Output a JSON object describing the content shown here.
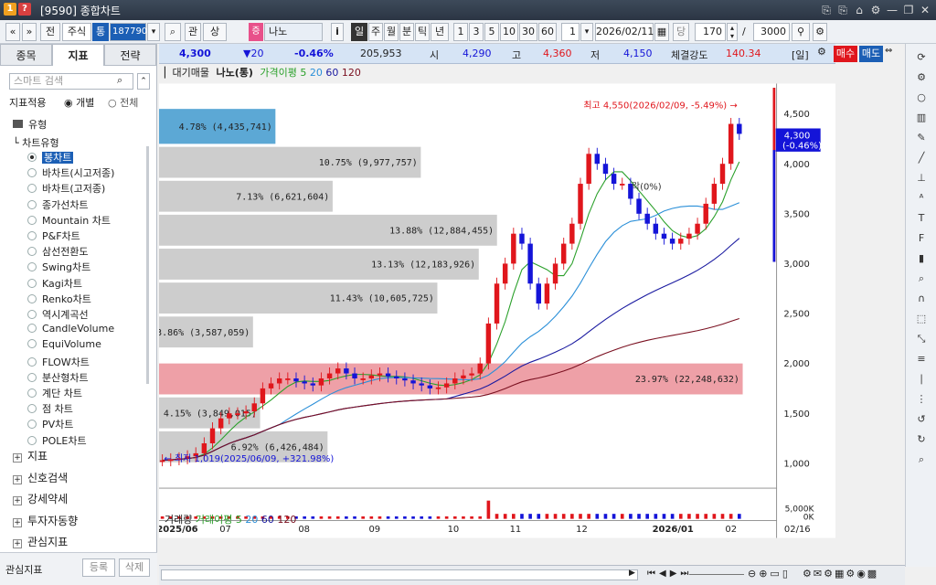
{
  "window": {
    "badge1": "1",
    "badge2": "?",
    "title": "[9590] 종합차트",
    "controls": [
      "⎘",
      "⎘",
      "⌂",
      "⚙",
      "—",
      "❐",
      "✕"
    ]
  },
  "toolbar": {
    "nav_prev": "«",
    "nav_down": "»",
    "btn_jeon": "전",
    "asset_type": "주식",
    "tong": "통",
    "code": "187790",
    "btn_gwan": "관",
    "btn_sang": "상",
    "jeung": "증",
    "stock_name": "나노",
    "info": "i",
    "periods": [
      "일",
      "주",
      "월",
      "분",
      "틱",
      "년"
    ],
    "active_period": "일",
    "intervals": [
      "1",
      "3",
      "5",
      "10",
      "30",
      "60"
    ],
    "num1": "1",
    "date": "2026/02/11",
    "dang": "당",
    "count": "170",
    "slash": "/",
    "total": "3000"
  },
  "left": {
    "tabs": [
      "종목",
      "지표",
      "전략"
    ],
    "active_tab": "지표",
    "search_placeholder": "스마트 검색",
    "apply_label": "지표적용",
    "apply_opt1": "개별",
    "apply_opt2": "전체",
    "section_type": "유형",
    "chart_type_header": "차트유형",
    "chart_types": [
      "봉차트",
      "바차트(시고저종)",
      "바차트(고저종)",
      "종가선차트",
      "Mountain 차트",
      "P&F차트",
      "삼선전환도",
      "Swing차트",
      "Kagi차트",
      "Renko차트",
      "역시계곡선",
      "CandleVolume",
      "EquiVolume",
      "FLOW차트",
      "분산형차트",
      "계단 차트",
      "점 차트",
      "PV차트",
      "POLE차트"
    ],
    "selected_type": "봉차트",
    "groups": [
      "지표",
      "신호검색",
      "강세약세",
      "투자자동향",
      "관심지표"
    ],
    "footer_label": "관심지표",
    "footer_btn1": "등록",
    "footer_btn2": "삭제"
  },
  "price": {
    "current": "4,300",
    "change": "▼20",
    "change_pct": "-0.46%",
    "volume": "205,953",
    "open_label": "시",
    "open": "4,290",
    "high_label": "고",
    "high": "4,360",
    "low_label": "저",
    "low": "4,150",
    "strength_label": "체결강도",
    "strength": "140.34",
    "period_tag": "[일]",
    "buy": "매수",
    "sell": "매도"
  },
  "chart_legend": {
    "vp": "대기매물",
    "name": "나노(통)",
    "ma_label": "가격이평 5",
    "ma20": "20",
    "ma60": "60",
    "ma120": "120"
  },
  "volume_legend": {
    "title": "거래량",
    "ma_label": "거래이평 5",
    "ma20": "20",
    "ma60": "60",
    "ma120": "120"
  },
  "annotations": {
    "high": "최고 4,550(2026/02/09, -5.49%)",
    "low": "최저 1,019(2025/06/09, +321.98%)",
    "price_tag": "4,300",
    "price_tag_pct": "(-0.46%)",
    "mid_label": "락(0%)"
  },
  "colors": {
    "up": "#e0161c",
    "down": "#1414d8",
    "ma5": "#2aa02a",
    "ma20": "#2a8fd8",
    "ma60": "#1a1aa0",
    "ma120": "#7a1020",
    "vp_bar": "#c8c8c8",
    "vp_highlight": "#e8808a",
    "vp_first": "#4a9ed0"
  },
  "chart_data": {
    "type": "candlestick",
    "y_ticks": [
      "4,500",
      "4,000",
      "3,500",
      "3,000",
      "2,500",
      "2,000",
      "1,500",
      "1,000"
    ],
    "ylim": [
      900,
      4720
    ],
    "x_ticks": [
      "2025/06",
      "07",
      "08",
      "09",
      "10",
      "11",
      "12",
      "2026/01",
      "02"
    ],
    "vol_ticks": [
      "5,000K",
      "0K"
    ],
    "last_date": "02/16",
    "volume_profile": [
      {
        "low": 4200,
        "high": 4550,
        "pct": 4.78,
        "label": "4.78% (4,435,741)"
      },
      {
        "low": 3860,
        "high": 4170,
        "pct": 10.75,
        "label": "10.75% (9,977,757)"
      },
      {
        "low": 3520,
        "high": 3830,
        "pct": 7.13,
        "label": "7.13% (6,621,604)"
      },
      {
        "low": 3180,
        "high": 3490,
        "pct": 13.88,
        "label": "13.88% (12,884,455)"
      },
      {
        "low": 2840,
        "high": 3150,
        "pct": 13.13,
        "label": "13.13% (12,183,926)"
      },
      {
        "low": 2500,
        "high": 2810,
        "pct": 11.43,
        "label": "11.43% (10,605,725)"
      },
      {
        "low": 2160,
        "high": 2470,
        "pct": 3.86,
        "label": "3.86% (3,587,059)"
      },
      {
        "low": 1690,
        "high": 2000,
        "pct": 23.97,
        "label": "23.97% (22,248,632)",
        "highlight": true
      },
      {
        "low": 1350,
        "high": 1660,
        "pct": 4.15,
        "label": "4.15% (3,849,015)"
      },
      {
        "low": 1010,
        "high": 1320,
        "pct": 6.92,
        "label": "6.92% (6,426,484)"
      }
    ],
    "close_path": [
      1030,
      1040,
      1050,
      1070,
      1100,
      1200,
      1350,
      1450,
      1500,
      1500,
      1520,
      1600,
      1750,
      1800,
      1850,
      1850,
      1820,
      1800,
      1780,
      1850,
      1900,
      1950,
      1900,
      1850,
      1850,
      1880,
      1900,
      1870,
      1850,
      1830,
      1800,
      1780,
      1750,
      1760,
      1800,
      1850,
      1880,
      1900,
      2000,
      2400,
      2800,
      3000,
      3300,
      3200,
      2800,
      2600,
      2800,
      3000,
      3200,
      3400,
      3800,
      4100,
      4000,
      3900,
      3800,
      3800,
      3650,
      3500,
      3400,
      3300,
      3250,
      3200,
      3250,
      3300,
      3400,
      3600,
      3800,
      4000,
      4400,
      4300
    ],
    "last_price": 4300
  }
}
